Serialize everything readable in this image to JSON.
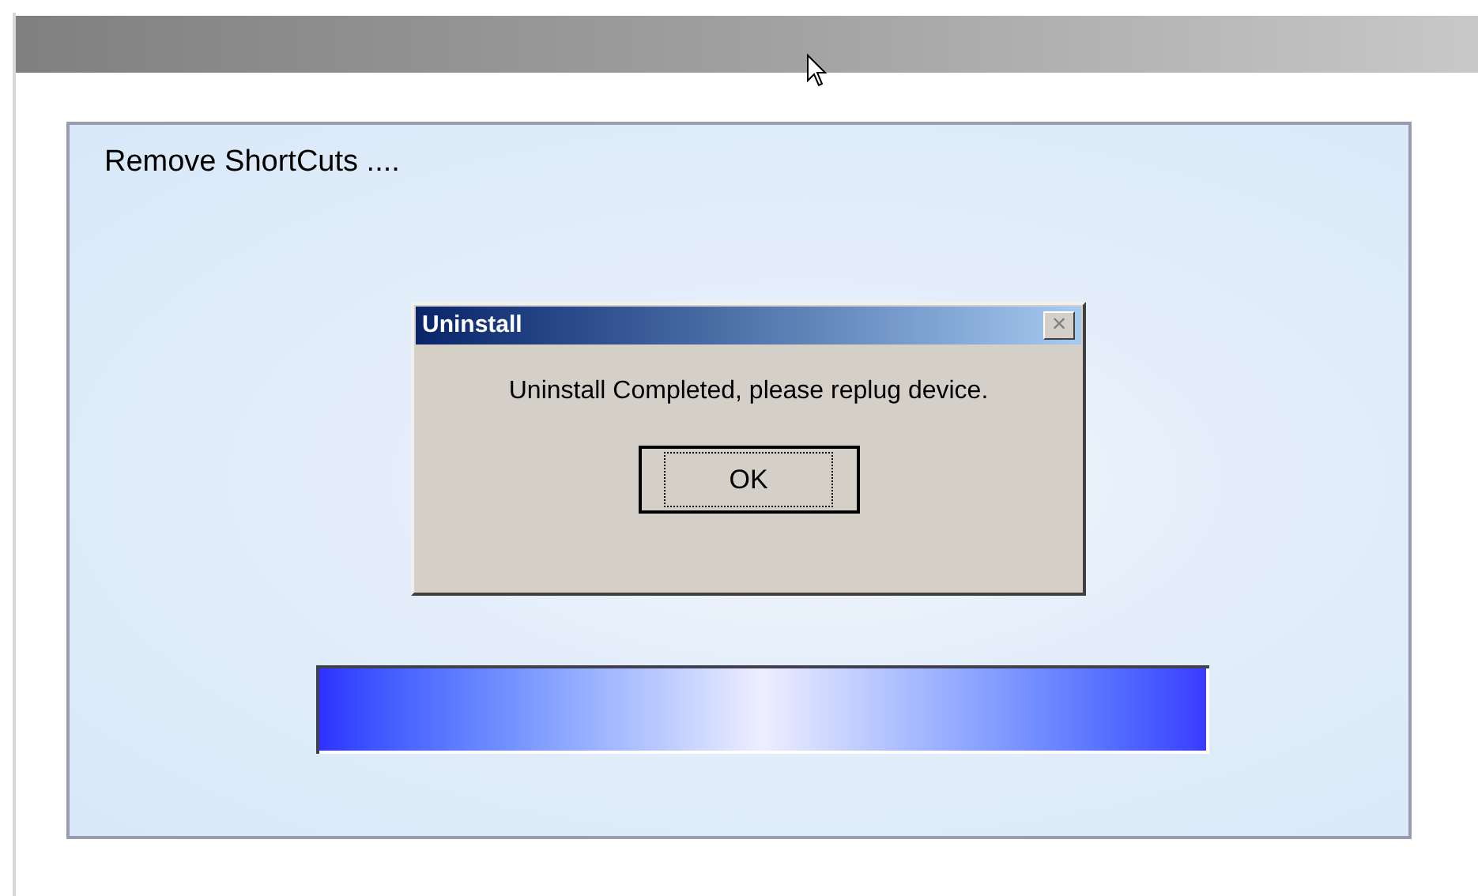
{
  "panel": {
    "heading": "Remove ShortCuts ...."
  },
  "dialog": {
    "title": "Uninstall",
    "close": "×",
    "message": "Uninstall Completed, please replug device.",
    "buttons": [
      {
        "label": "OK",
        "focused": true
      }
    ]
  },
  "progress": {
    "level": 1
  }
}
